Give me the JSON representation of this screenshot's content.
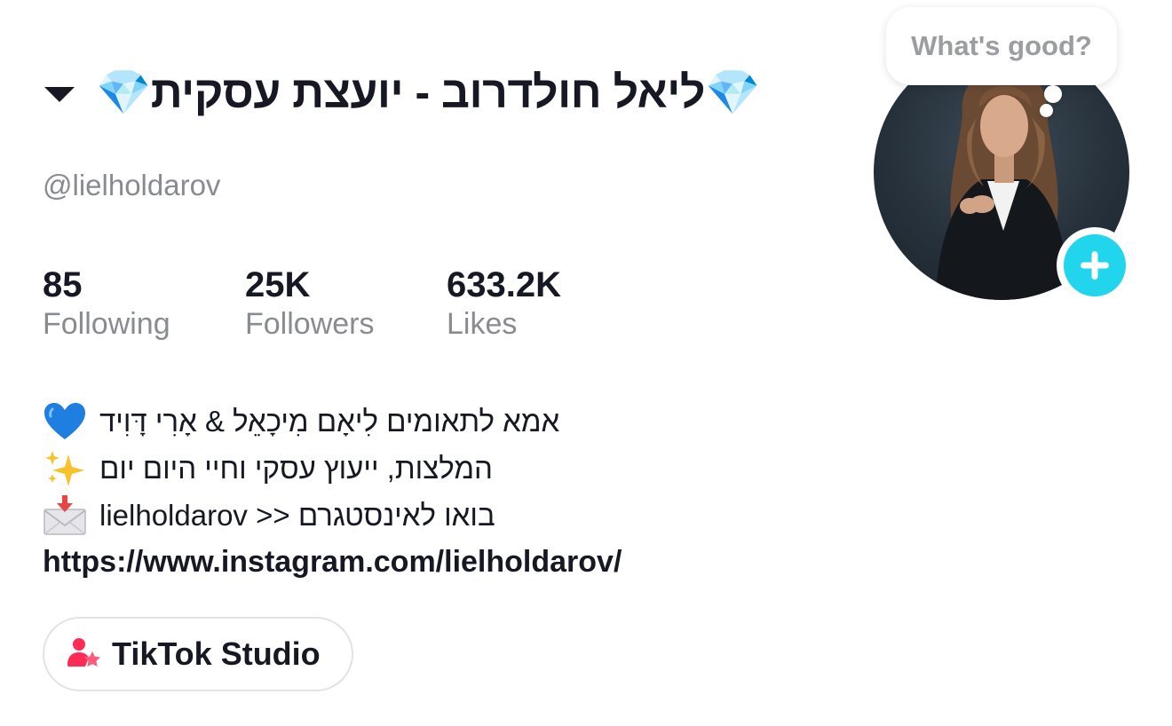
{
  "profile": {
    "display_name": "💎ליאל חולדרוב - יועצת עסקית💎",
    "username": "@lielholdarov"
  },
  "stats": [
    {
      "value": "85",
      "label": "Following"
    },
    {
      "value": "25K",
      "label": "Followers"
    },
    {
      "value": "633.2K",
      "label": "Likes"
    }
  ],
  "bio": {
    "line1": "אמא לתאומים לִיאָם מִיכָאֵל & אָרִי דָּוִיד",
    "line2": "המלצות, ייעוץ עסקי וחיי היום יום",
    "line3": "בואו לאינסטגרם << lielholdarov",
    "link": "https://www.instagram.com/lielholdarov/",
    "icons": [
      "blue-heart-icon",
      "sparkles-icon",
      "envelope-with-arrow-icon"
    ]
  },
  "studio_button": {
    "label": "TikTok Studio",
    "icon": "tiktok-studio-icon"
  },
  "avatar": {
    "bubble_text": "What's good?",
    "add_icon": "plus-icon",
    "accent_color": "#20d5ec"
  },
  "colors": {
    "primary_text": "#161823",
    "secondary_text": "#8a8b91"
  }
}
